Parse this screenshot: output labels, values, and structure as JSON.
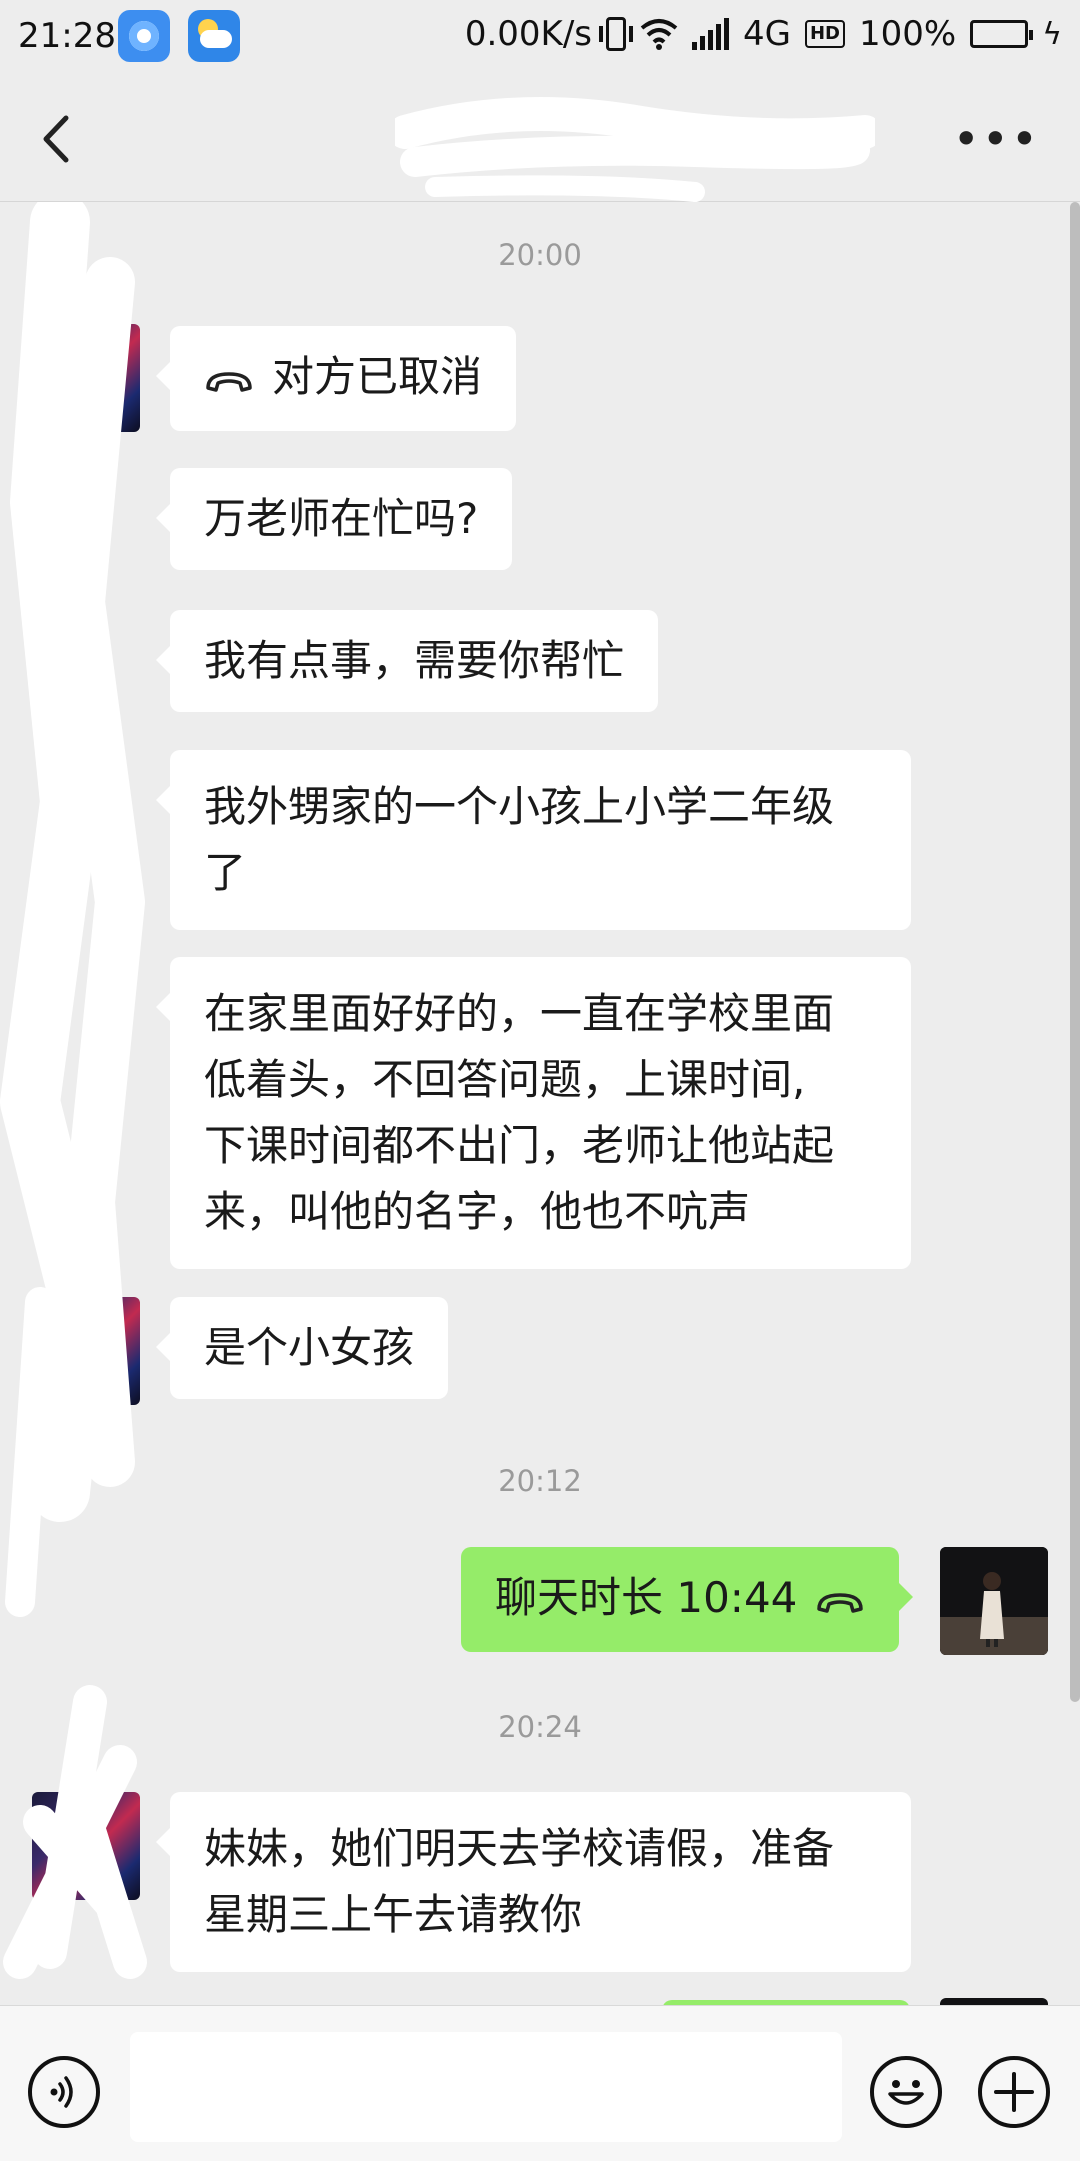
{
  "status_bar": {
    "time": "21:28",
    "network_speed": "0.00K/s",
    "network_type": "4G",
    "hd_badge": "HD",
    "battery": "100%",
    "icons": [
      "browser-app-icon",
      "weather-app-icon",
      "vibrate-icon",
      "wifi-icon",
      "signal-icon",
      "battery-icon",
      "charging-icon"
    ]
  },
  "header": {
    "back_icon": "chevron-left-icon",
    "title": "",
    "more_icon": "more-icon"
  },
  "messages": [
    {
      "type": "timestamp",
      "text": "20:00"
    },
    {
      "type": "incoming",
      "call_icon": "phone-hangup-icon",
      "text": "对方已取消"
    },
    {
      "type": "incoming",
      "text": "万老师在忙吗?"
    },
    {
      "type": "incoming",
      "text": "我有点事，需要你帮忙"
    },
    {
      "type": "incoming",
      "lines": [
        "我外甥家的一个小孩上小学二年级",
        "了"
      ]
    },
    {
      "type": "incoming",
      "lines": [
        "在家里面好好的，一直在学校里面",
        "低着头，不回答问题，上课时间,",
        "下课时间都不出门，老师让他站起",
        "来，叫他的名字，他也不吭声"
      ]
    },
    {
      "type": "incoming",
      "text": "是个小女孩"
    },
    {
      "type": "timestamp",
      "text": "20:12"
    },
    {
      "type": "outgoing",
      "text": "聊天时长 10:44",
      "call_icon": "phone-hangup-icon"
    },
    {
      "type": "timestamp",
      "text": "20:24"
    },
    {
      "type": "incoming",
      "lines": [
        "妹妹，她们明天去学校请假，准备",
        "星期三上午去请教你"
      ]
    }
  ],
  "input_bar": {
    "voice_icon": "voice-icon",
    "input_value": "",
    "emoji_icon": "emoji-icon",
    "plus_icon": "plus-icon"
  },
  "colors": {
    "background": "#ededed",
    "incoming_bubble": "#ffffff",
    "outgoing_bubble": "#95ec69",
    "timestamp": "#9a9a9a",
    "battery_fill": "#2fb04a"
  }
}
